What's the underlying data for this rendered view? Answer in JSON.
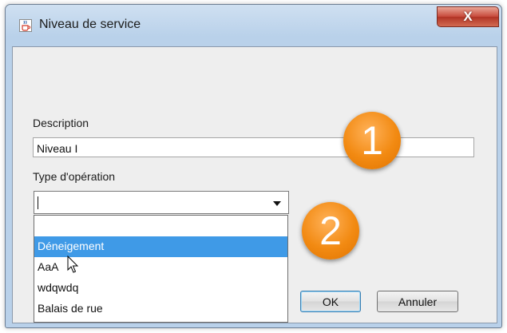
{
  "window": {
    "title": "Niveau de service",
    "close_label": "X"
  },
  "form": {
    "description_label": "Description",
    "description_value": "Niveau I",
    "operation_label": "Type d'opération",
    "operation_value": ""
  },
  "dropdown": {
    "options": [
      "",
      "Déneigement",
      "AaA",
      "wdqwdq",
      "Balais de rue"
    ],
    "highlighted_index": 1
  },
  "callouts": [
    "1",
    "2"
  ],
  "buttons": {
    "ok": "OK",
    "cancel": "Annuler"
  },
  "colors": {
    "highlight": "#3f9ae7",
    "callout": "#f28a12",
    "close_button": "#c7493a"
  },
  "icons": {
    "app": "java-cup-icon",
    "cursor": "mouse-pointer-icon"
  }
}
